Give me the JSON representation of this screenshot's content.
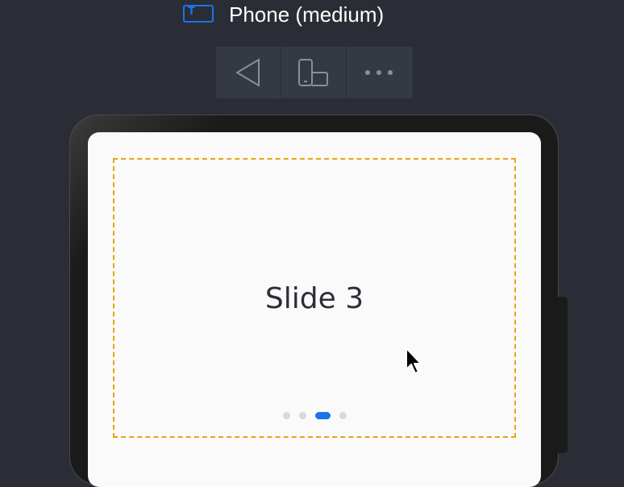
{
  "header": {
    "device_icon": "text-frame-icon",
    "device_icon_glyph": "T",
    "title": "Phone (medium)"
  },
  "toolbar": {
    "items": [
      {
        "icon": "back-triangle-icon"
      },
      {
        "icon": "rotate-device-icon"
      },
      {
        "icon": "more-options-icon"
      }
    ]
  },
  "carousel": {
    "slide_text": "Slide 3",
    "slide_count": 4,
    "active_index": 2
  },
  "colors": {
    "accent": "#1a73e8",
    "dashed_border": "#e8a317",
    "background": "#2a2d35"
  }
}
